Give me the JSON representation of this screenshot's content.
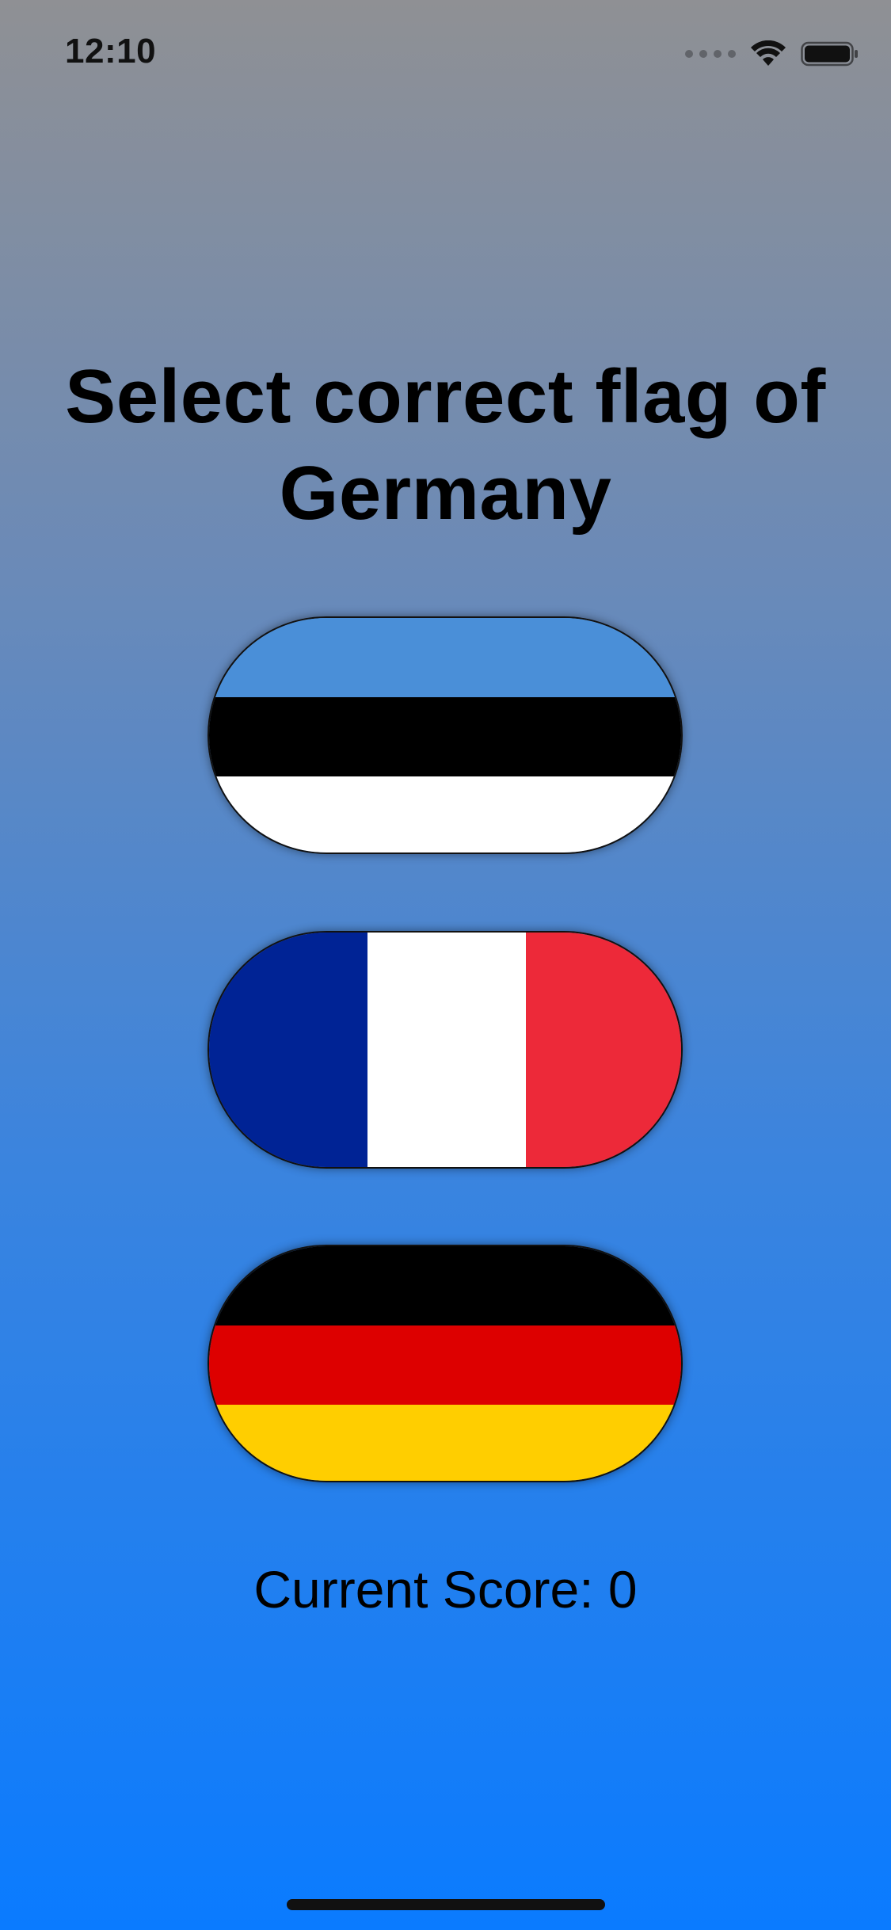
{
  "status_bar": {
    "time": "12:10",
    "icons": [
      "cellular-signal-icon",
      "wifi-icon",
      "battery-icon"
    ]
  },
  "question": {
    "title": "Select correct flag of Germany"
  },
  "flags": [
    {
      "country": "Estonia",
      "colors": [
        "#4a8fd8",
        "#000000",
        "#ffffff"
      ],
      "orientation": "horizontal"
    },
    {
      "country": "France",
      "colors": [
        "#002395",
        "#ffffff",
        "#ed2939"
      ],
      "orientation": "vertical"
    },
    {
      "country": "Germany",
      "colors": [
        "#000000",
        "#dd0000",
        "#ffce00"
      ],
      "orientation": "horizontal"
    }
  ],
  "score": {
    "text": "Current Score: 0"
  },
  "colors": {
    "gradient_top": "#8f9094",
    "gradient_bottom": "#0a7bff"
  }
}
